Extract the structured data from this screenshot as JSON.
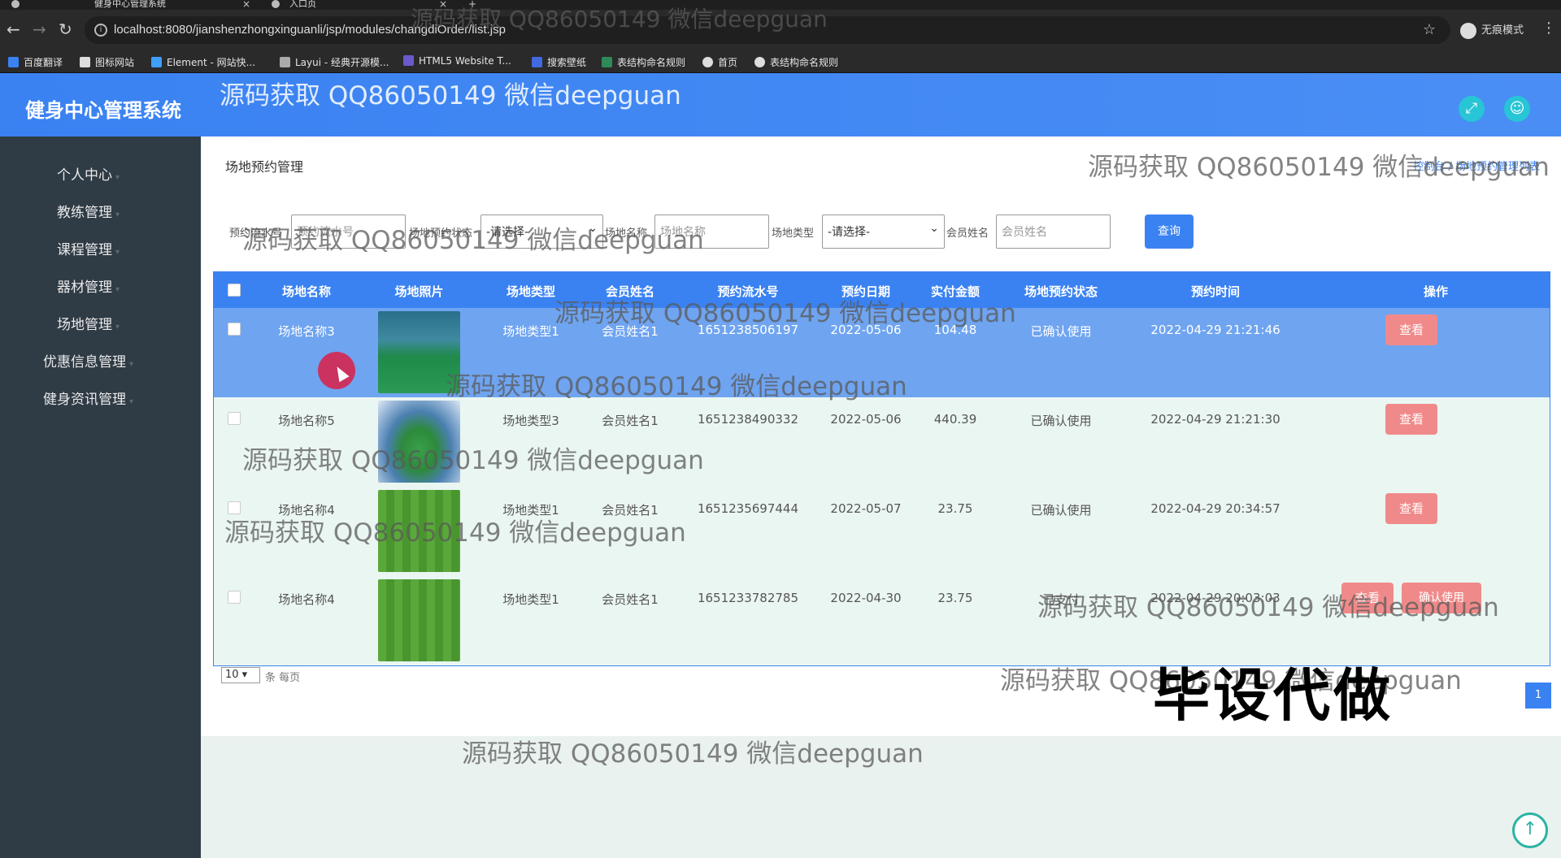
{
  "browser": {
    "tabs": [
      {
        "label": "健身中心管理系统"
      },
      {
        "label": "入口页"
      }
    ],
    "url": "localhost:8080/jianshenzhongxinguanli/jsp/modules/changdiOrder/list.jsp",
    "incognito_label": "无痕模式",
    "bookmarks": [
      {
        "label": "百度翻译"
      },
      {
        "label": "图标网站"
      },
      {
        "label": "Element - 网站快..."
      },
      {
        "label": "Layui - 经典开源模..."
      },
      {
        "label": "HTML5 Website T..."
      },
      {
        "label": "搜索壁纸"
      },
      {
        "label": "表结构命名规则"
      },
      {
        "label": "首页"
      },
      {
        "label": "表结构命名规则"
      }
    ]
  },
  "app": {
    "title": "健身中心管理系统",
    "header_icons": [
      "expand-icon",
      "user-icon"
    ]
  },
  "sidebar": {
    "items": [
      {
        "label": "个人中心"
      },
      {
        "label": "教练管理"
      },
      {
        "label": "课程管理"
      },
      {
        "label": "器材管理"
      },
      {
        "label": "场地管理"
      },
      {
        "label": "优惠信息管理"
      },
      {
        "label": "健身资讯管理"
      }
    ]
  },
  "page": {
    "title": "场地预约管理",
    "breadcrumb_right": "控制台 / 场地预约管理列表"
  },
  "filters": {
    "order_no_label": "预约流水号",
    "order_no_placeholder": "预约流水号",
    "status_label": "场地预约状态",
    "status_value": "-请选择-",
    "name_label": "场地名称",
    "name_placeholder": "场地名称",
    "type_label": "场地类型",
    "type_value": "-请选择-",
    "member_label": "会员姓名",
    "member_placeholder": "会员姓名",
    "search_button": "查询"
  },
  "table": {
    "headers": [
      "场地名称",
      "场地照片",
      "场地类型",
      "会员姓名",
      "预约流水号",
      "预约日期",
      "实付金额",
      "场地预约状态",
      "预约时间",
      "操作"
    ],
    "rows": [
      {
        "name": "场地名称3",
        "type": "场地类型1",
        "member": "会员姓名1",
        "order_no": "1651238506197",
        "date": "2022-05-06",
        "amount": "104.48",
        "status": "已确认使用",
        "time": "2022-04-29 21:21:46",
        "actions": [
          "查看"
        ],
        "photo": "indoor-court"
      },
      {
        "name": "场地名称5",
        "type": "场地类型3",
        "member": "会员姓名1",
        "order_no": "1651238490332",
        "date": "2022-05-06",
        "amount": "440.39",
        "status": "已确认使用",
        "time": "2022-04-29 21:21:30",
        "actions": [
          "查看"
        ],
        "photo": "stadium"
      },
      {
        "name": "场地名称4",
        "type": "场地类型1",
        "member": "会员姓名1",
        "order_no": "1651235697444",
        "date": "2022-05-07",
        "amount": "23.75",
        "status": "已确认使用",
        "time": "2022-04-29 20:34:57",
        "actions": [
          "查看"
        ],
        "photo": "grass-field"
      },
      {
        "name": "场地名称4",
        "type": "场地类型1",
        "member": "会员姓名1",
        "order_no": "1651233782785",
        "date": "2022-04-30",
        "amount": "23.75",
        "status": "已支付",
        "time": "2022-04-29 20:03:03",
        "actions": [
          "查看",
          "确认使用"
        ],
        "photo": "grass-field"
      }
    ]
  },
  "pager": {
    "page_size": "10",
    "page_size_label": "条 每页",
    "current_page": "1"
  },
  "watermarks": {
    "text": "源码获取 QQ86050149 微信deepguan",
    "big_text": "毕设代做"
  },
  "colors": {
    "primary": "#3a82f2",
    "sidebar": "#2f3b45",
    "danger_button": "#f08a8a",
    "row_highlight": "#6fa4f0"
  }
}
